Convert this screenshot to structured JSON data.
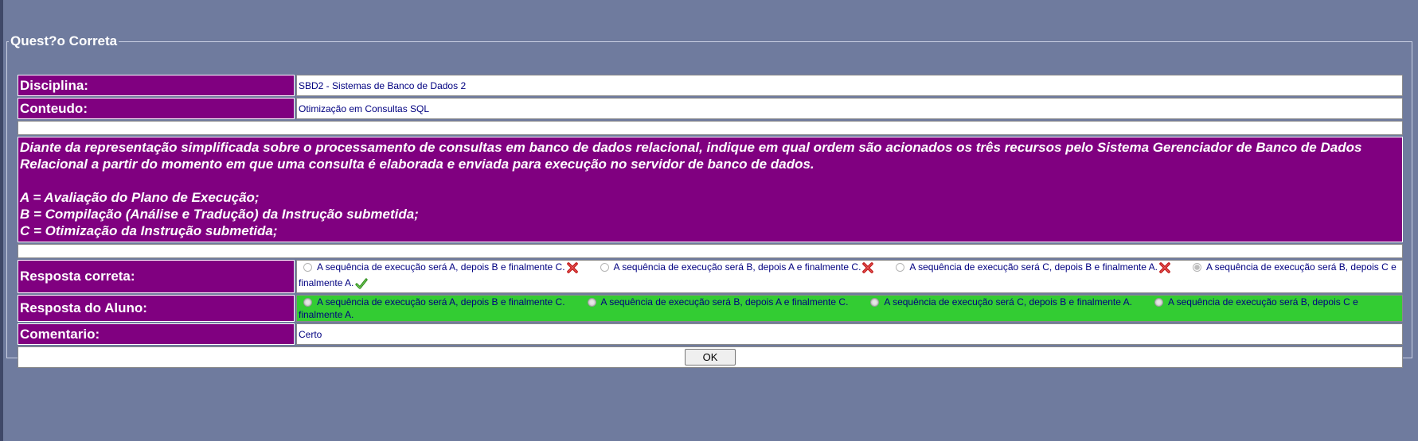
{
  "legend": "Quest?o Correta",
  "rows": {
    "disciplina_label": "Disciplina:",
    "disciplina_value": "SBD2 - Sistemas de Banco de Dados 2",
    "conteudo_label": "Conteudo:",
    "conteudo_value": "Otimização em Consultas SQL",
    "resposta_correta_label": "Resposta correta:",
    "resposta_aluno_label": "Resposta do Aluno:",
    "comentario_label": "Comentario:",
    "comentario_value": "Certo"
  },
  "question": {
    "statement": "Diante da representação simplificada sobre o processamento de consultas em banco de dados relacional, indique em qual ordem são acionados os três recursos pelo Sistema Gerenciador de Banco de Dados Relacional a partir do momento em que uma consulta é elaborada e enviada para execução no servidor de banco de dados.",
    "item_a": "A = Avaliação do Plano de Execução;",
    "item_b": "B = Compilação (Análise e Tradução) da Instrução submetida;",
    "item_c": "C = Otimização da Instrução submetida;"
  },
  "options": [
    "A sequência de execução será A, depois B e finalmente C.",
    "A sequência de execução será B, depois A e finalmente C.",
    "A sequência de execução será C, depois B e finalmente A.",
    "A sequência de execução será B, depois C e finalmente A."
  ],
  "correct_marks": [
    "wrong-icon",
    "wrong-icon",
    "wrong-icon",
    "check-icon"
  ],
  "colors": {
    "background": "#6f7b9e",
    "label_bg": "#800080",
    "student_answer_bg": "#33cc33",
    "value_text": "#000080"
  },
  "ok_label": "OK"
}
